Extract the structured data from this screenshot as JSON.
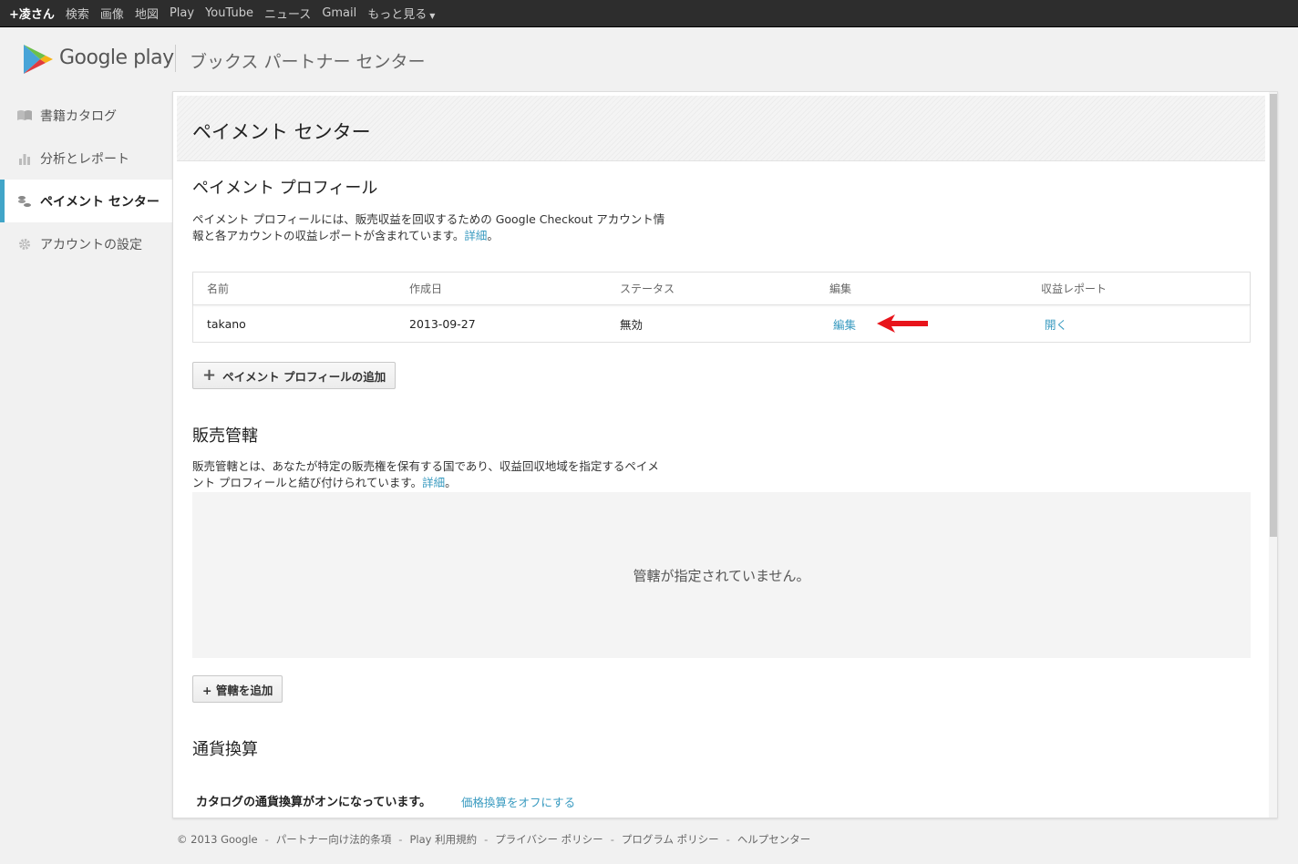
{
  "topbar": {
    "user": "+凌さん",
    "links": [
      "検索",
      "画像",
      "地図",
      "Play",
      "YouTube",
      "ニュース",
      "Gmail"
    ],
    "more": "もっと見る"
  },
  "header": {
    "logo_text": "Google play",
    "title": "ブックス パートナー センター"
  },
  "sidebar": {
    "items": [
      {
        "label": "書籍カタログ",
        "icon": "book-icon"
      },
      {
        "label": "分析とレポート",
        "icon": "bar-chart-icon"
      },
      {
        "label": "ペイメント センター",
        "icon": "coins-icon",
        "active": true
      },
      {
        "label": "アカウントの設定",
        "icon": "gear-icon"
      }
    ]
  },
  "main": {
    "title": "ペイメント センター",
    "payment_profile": {
      "title": "ペイメント プロフィール",
      "desc_line1": "ペイメント プロフィールには、販売収益を回収するための Google Checkout アカウント情",
      "desc_line2": "報と各アカウントの収益レポートが含まれています。",
      "detail_link": "詳細",
      "period": "。",
      "columns": [
        "名前",
        "作成日",
        "ステータス",
        "編集",
        "収益レポート"
      ],
      "rows": [
        {
          "name": "takano",
          "created": "2013-09-27",
          "status": "無効",
          "edit": "編集",
          "report": "開く"
        }
      ],
      "add_button": "ペイメント プロフィールの追加"
    },
    "jurisdiction": {
      "title": "販売管轄",
      "desc_line1": "販売管轄とは、あなたが特定の販売権を保有する国であり、収益回収地域を指定するペイメ",
      "desc_line2": "ント プロフィールと結び付けられています。",
      "detail_link": "詳細",
      "period": "。",
      "empty": "管轄が指定されていません。",
      "add_button": "+ 管轄を追加"
    },
    "currency": {
      "title": "通貨換算",
      "status": "カタログの通貨換算がオンになっています。",
      "toggle_link": "価格換算をオフにする"
    }
  },
  "footer": {
    "items": [
      "© 2013 Google",
      "パートナー向け法的条項",
      "Play 利用規約",
      "プライバシー ポリシー",
      "プログラム ポリシー",
      "ヘルプセンター"
    ],
    "separator": "-"
  },
  "colors": {
    "accent": "#41a5c8",
    "link": "#3a9bc0",
    "arrow": "#e8141b"
  }
}
